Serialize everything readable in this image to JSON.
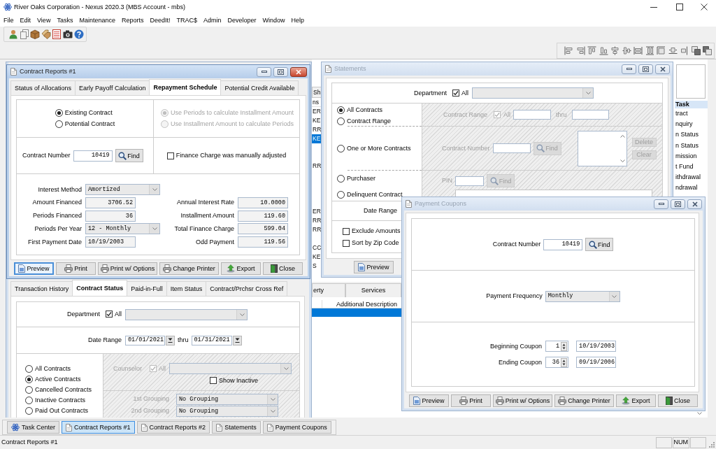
{
  "window": {
    "title": "River Oaks Corporation - Nexus 2020.3 (MBS Account - mbs)"
  },
  "menu": [
    "File",
    "Edit",
    "View",
    "Tasks",
    "Maintenance",
    "Reports",
    "DeedIt!",
    "TRAC$",
    "Admin",
    "Developer",
    "Window",
    "Help"
  ],
  "task_center": {
    "left_tab": "Sh",
    "left_header": "ns",
    "left_rows": [
      {
        "text": "ER",
        "selected": false
      },
      {
        "text": "KE",
        "selected": false
      },
      {
        "text": "RR",
        "selected": false
      },
      {
        "text": "KE",
        "selected": true
      },
      {
        "selected": false
      },
      {
        "selected": false
      },
      {
        "text": "RR",
        "selected": false
      },
      {
        "selected": false
      },
      {
        "selected": false
      },
      {
        "selected": false
      },
      {
        "selected": false
      },
      {
        "text": "ER",
        "selected": false
      },
      {
        "text": "RR",
        "selected": false
      },
      {
        "text": "RR",
        "selected": false
      },
      {
        "selected": false
      },
      {
        "text": "CC",
        "selected": false
      },
      {
        "text": "KE",
        "selected": false
      },
      {
        "text": "S",
        "selected": false
      }
    ],
    "tabs": [
      {
        "label": "erty",
        "selected": false
      },
      {
        "label": "Services",
        "selected": false
      }
    ],
    "column_header": "Additional Description",
    "detail_rows": [
      {
        "selected": true
      }
    ],
    "task_list": {
      "header": "Task",
      "items": [
        {
          "label": "tract",
          "selected": false
        },
        {
          "label": "nquiry",
          "selected": false
        },
        {
          "label": "n Status",
          "selected": false
        },
        {
          "label": "n Status",
          "selected": false
        },
        {
          "label": "mission",
          "selected": false
        },
        {
          "label": "t Fund",
          "selected": false
        },
        {
          "label": "ithdrawal",
          "selected": false
        },
        {
          "label": "ndrawal",
          "selected": false
        }
      ]
    }
  },
  "contract_reports_2": {
    "tabs": [
      {
        "label": "Transaction History",
        "selected": false
      },
      {
        "label": "Contract Status",
        "selected": true
      },
      {
        "label": "Paid-in-Full",
        "selected": false
      },
      {
        "label": "Item Status",
        "selected": false
      },
      {
        "label": "Contract/Prchsr Cross Ref",
        "selected": false
      }
    ],
    "department": {
      "label": "Department",
      "all_label": "All",
      "all_checked": true
    },
    "date_range": {
      "label": "Date Range",
      "from": "01/01/2021",
      "thru_label": "thru",
      "to": "01/31/2021"
    },
    "status_options": [
      {
        "label": "All Contracts",
        "selected": false
      },
      {
        "label": "Active Contracts",
        "selected": true
      },
      {
        "label": "Cancelled Contracts",
        "selected": false
      },
      {
        "label": "Inactive Contracts",
        "selected": false
      },
      {
        "label": "Paid Out Contracts",
        "selected": false
      }
    ],
    "counselor": {
      "disabled": true,
      "label": "Counselor",
      "all_label": "All",
      "all_checked": true,
      "show_inactive": {
        "label": "Show Inactive",
        "checked": false
      }
    },
    "grouping": {
      "disabled": true,
      "fields": [
        {
          "label": "1st Grouping",
          "value": "No Grouping"
        },
        {
          "label": "2nd Grouping",
          "value": "No Grouping"
        }
      ]
    }
  },
  "contract_reports_1": {
    "title": "Contract Reports #1",
    "active": true,
    "tabs": [
      {
        "label": "Status of Allocations",
        "selected": false
      },
      {
        "label": "Early Payoff Calculation",
        "selected": false
      },
      {
        "label": "Repayment Schedule",
        "selected": true
      },
      {
        "label": "Potential Credit Available",
        "selected": false
      }
    ],
    "contract_type": [
      {
        "label": "Existing Contract",
        "selected": true
      },
      {
        "label": "Potential Contract",
        "selected": false
      }
    ],
    "calculation": [
      {
        "label": "Use Periods to calculate Installment Amount",
        "selected": true,
        "disabled": true
      },
      {
        "label": "Use Installment Amount to calculate Periods",
        "selected": false,
        "disabled": true
      }
    ],
    "contract_number": {
      "label": "Contract Number",
      "value": "10419",
      "find": "Find"
    },
    "finance_charge": {
      "label": "Finance Charge was manually adjusted",
      "checked": false
    },
    "fields_left": [
      {
        "label": "Interest Method",
        "value": "Amortized",
        "kind": "dropdown"
      },
      {
        "label": "Amount Financed",
        "value": "3706.52",
        "kind": "number"
      },
      {
        "label": "Periods Financed",
        "value": "36",
        "kind": "number"
      },
      {
        "label": "Periods Per Year",
        "value": "12 - Monthly",
        "kind": "dropdown"
      },
      {
        "label": "First Payment Date",
        "value": "10/19/2003",
        "kind": "date"
      }
    ],
    "fields_right": [
      {
        "label": "Annual Interest Rate",
        "value": "10.0000",
        "kind": "number"
      },
      {
        "label": "Installment Amount",
        "value": "119.60",
        "kind": "number"
      },
      {
        "label": "Total Finance Charge",
        "value": "599.04",
        "kind": "number"
      },
      {
        "label": "Odd Payment",
        "value": "119.56",
        "kind": "number"
      }
    ],
    "buttons": [
      {
        "label": "Preview",
        "kind": "preview",
        "focused": true
      },
      {
        "label": "Print",
        "kind": "print",
        "focused": false
      },
      {
        "label": "Print w/ Options",
        "kind": "print-options",
        "focused": false
      },
      {
        "label": "Change Printer",
        "kind": "change-printer",
        "focused": false
      },
      {
        "label": "Export",
        "kind": "export",
        "focused": false
      },
      {
        "label": "Close",
        "kind": "close",
        "focused": false
      }
    ]
  },
  "statements": {
    "title": "Statements",
    "active": false,
    "department": {
      "label": "Department",
      "all_label": "All",
      "all_checked": true
    },
    "selection": [
      {
        "label": "All Contracts",
        "selected": true
      },
      {
        "label": "Contract Range",
        "selected": false
      },
      {
        "label": "One or More Contracts",
        "selected": false
      },
      {
        "label": "Purchaser",
        "selected": false
      },
      {
        "label": "Delinquent Contract",
        "selected": false
      }
    ],
    "contract_range": {
      "disabled": true,
      "label": "Contract Range",
      "all_label": "All",
      "all_checked": true,
      "thru_label": "thru"
    },
    "contract_numbers": {
      "disabled": true,
      "label": "Contract Number",
      "find": "Find",
      "buttons": [
        "Delete",
        "Clear"
      ]
    },
    "purchaser": {
      "disabled": true,
      "label": "PIN",
      "find": "Find"
    },
    "date_range": {
      "label": "Date Range"
    },
    "options": [
      {
        "label": "Exclude Amounts",
        "checked": false
      },
      {
        "label": "Sort by Zip Code",
        "checked": false
      }
    ],
    "buttons": [
      {
        "label": "Preview",
        "kind": "preview",
        "focused": false
      }
    ]
  },
  "payment_coupons": {
    "title": "Payment Coupons",
    "active": false,
    "contract_number": {
      "label": "Contract Number",
      "value": "10419",
      "find": "Find"
    },
    "payment_frequency": {
      "label": "Payment Frequency",
      "value": "Monthly"
    },
    "coupons": [
      {
        "label": "Beginning Coupon",
        "number": "1",
        "date": "10/19/2003"
      },
      {
        "label": "Ending Coupon",
        "number": "36",
        "date": "09/19/2006"
      }
    ],
    "buttons": [
      {
        "label": "Preview",
        "kind": "preview",
        "focused": false
      },
      {
        "label": "Print",
        "kind": "print",
        "focused": false
      },
      {
        "label": "Print w/ Options",
        "kind": "print-options",
        "focused": false
      },
      {
        "label": "Change Printer",
        "kind": "change-printer",
        "focused": false
      },
      {
        "label": "Export",
        "kind": "export",
        "focused": false
      },
      {
        "label": "Close",
        "kind": "close",
        "focused": false
      }
    ]
  },
  "taskbar": [
    {
      "label": "Task Center",
      "kind": "task-center",
      "selected": false
    },
    {
      "label": "Contract Reports #1",
      "kind": "document",
      "selected": true
    },
    {
      "label": "Contract Reports #2",
      "kind": "document",
      "selected": false
    },
    {
      "label": "Statements",
      "kind": "document",
      "selected": false
    },
    {
      "label": "Payment Coupons",
      "kind": "document",
      "selected": false
    }
  ],
  "status_bar": {
    "text": "Contract Reports #1",
    "indicators": [
      "NUM"
    ]
  }
}
